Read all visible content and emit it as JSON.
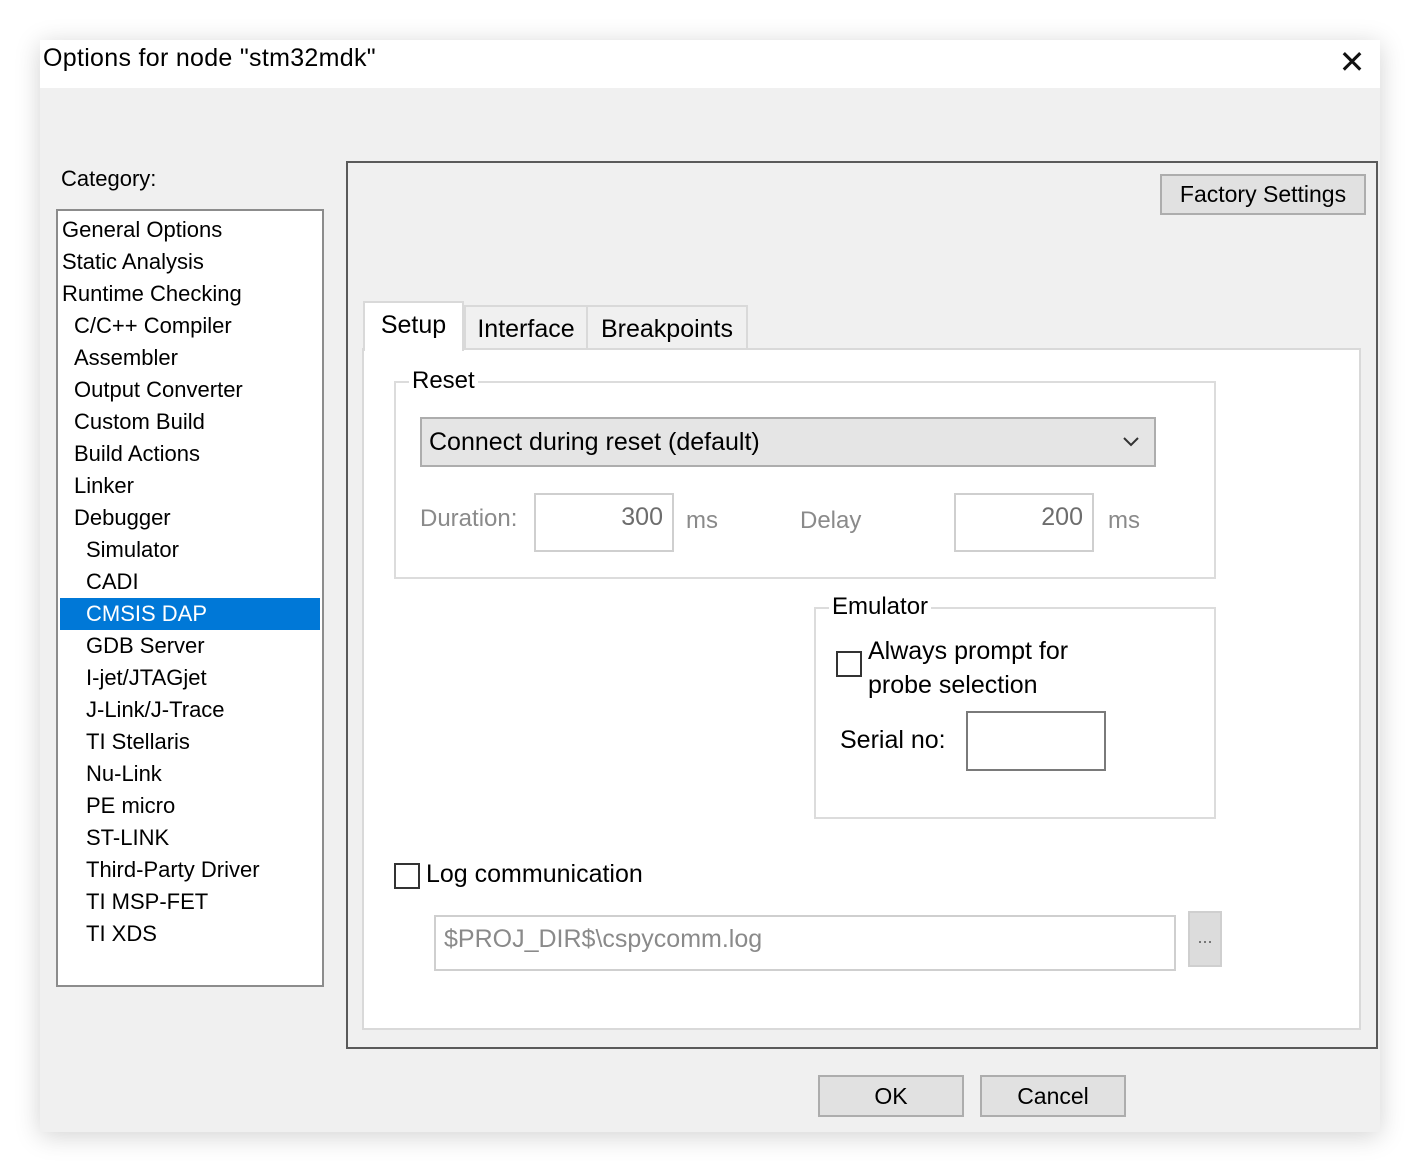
{
  "window": {
    "title": "Options for node \"stm32mdk\"",
    "close_glyph": "✕"
  },
  "category": {
    "label": "Category:",
    "items": [
      {
        "label": "General Options"
      },
      {
        "label": "Static Analysis"
      },
      {
        "label": "Runtime Checking"
      },
      {
        "label": "C/C++ Compiler"
      },
      {
        "label": "Assembler"
      },
      {
        "label": "Output Converter"
      },
      {
        "label": "Custom Build"
      },
      {
        "label": "Build Actions"
      },
      {
        "label": "Linker"
      },
      {
        "label": "Debugger"
      },
      {
        "label": "Simulator"
      },
      {
        "label": "CADI"
      },
      {
        "label": "CMSIS DAP"
      },
      {
        "label": "GDB Server"
      },
      {
        "label": "I-jet/JTAGjet"
      },
      {
        "label": "J-Link/J-Trace"
      },
      {
        "label": "TI Stellaris"
      },
      {
        "label": "Nu-Link"
      },
      {
        "label": "PE micro"
      },
      {
        "label": "ST-LINK"
      },
      {
        "label": "Third-Party Driver"
      },
      {
        "label": "TI MSP-FET"
      },
      {
        "label": "TI XDS"
      }
    ],
    "selected": "CMSIS DAP"
  },
  "factory_settings_label": "Factory Settings",
  "tabs": [
    {
      "label": "Setup",
      "active": true
    },
    {
      "label": "Interface",
      "active": false
    },
    {
      "label": "Breakpoints",
      "active": false
    }
  ],
  "reset": {
    "legend": "Reset",
    "mode_value": "Connect during reset (default)",
    "duration_label": "Duration:",
    "duration_value": "300",
    "duration_unit": "ms",
    "delay_label": "Delay",
    "delay_value": "200",
    "delay_unit": "ms"
  },
  "emulator": {
    "legend": "Emulator",
    "always_prompt_line1": "Always prompt for",
    "always_prompt_line2": "probe selection",
    "always_prompt_checked": false,
    "serial_label": "Serial no:",
    "serial_value": ""
  },
  "log": {
    "label": "Log communication",
    "checked": false,
    "path_value": "$PROJ_DIR$\\cspycomm.log",
    "browse_label": "..."
  },
  "buttons": {
    "ok": "OK",
    "cancel": "Cancel"
  },
  "colors": {
    "selection": "#0078d7",
    "dialog_bg": "#f0f0f0",
    "button_bg": "#e1e1e1"
  }
}
